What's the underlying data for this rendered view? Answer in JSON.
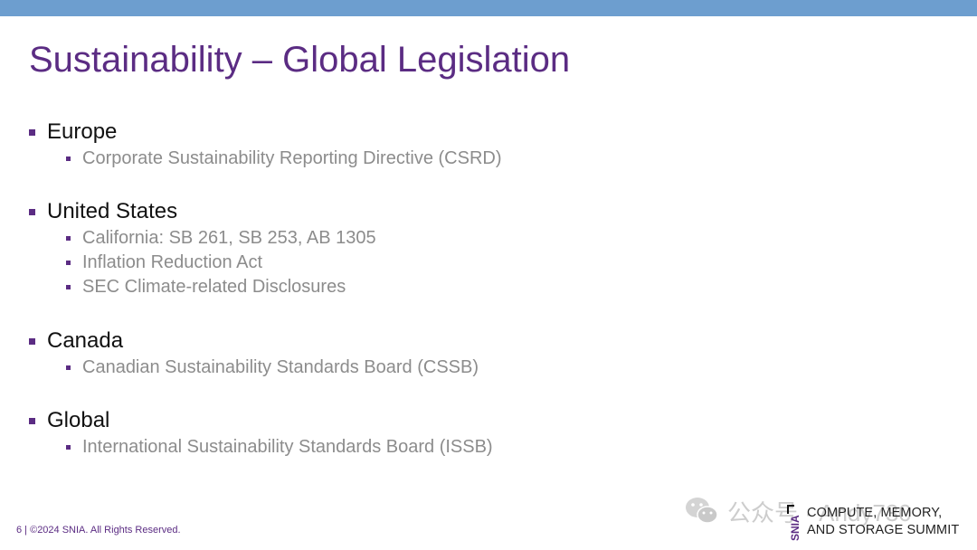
{
  "slide": {
    "title": "Sustainability – Global Legislation",
    "sections": [
      {
        "region": "Europe",
        "items": [
          "Corporate Sustainability Reporting Directive (CSRD)"
        ]
      },
      {
        "region": "United States",
        "items": [
          "California: SB 261, SB 253, AB 1305",
          "Inflation Reduction Act",
          "SEC Climate-related Disclosures"
        ]
      },
      {
        "region": "Canada",
        "items": [
          "Canadian Sustainability Standards Board (CSSB)"
        ]
      },
      {
        "region": "Global",
        "items": [
          "International Sustainability Standards Board (ISSB)"
        ]
      }
    ],
    "footer": "6 | ©2024 SNIA. All Rights Reserved."
  },
  "logo": {
    "mark": "SNIA",
    "line1": "COMPUTE, MEMORY,",
    "line2": "AND STORAGE SUMMIT"
  },
  "watermark": {
    "icon": "wechat-icon",
    "text": "公众号 · Andy730"
  },
  "colors": {
    "accent": "#5b2c83",
    "topbar": "#6d9ecf",
    "subtext": "#8c8c8c"
  }
}
